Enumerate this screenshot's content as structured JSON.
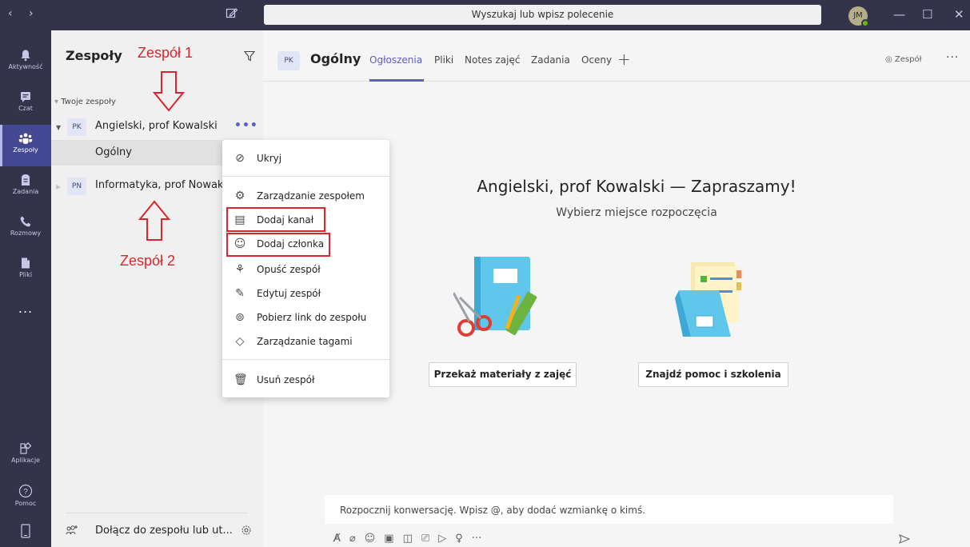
{
  "titlebar": {
    "search_text": "Wyszukaj lub wpisz polecenie",
    "avatar_initials": "JM"
  },
  "appbar": {
    "items": [
      {
        "label": "Aktywność",
        "icon": "bell-icon"
      },
      {
        "label": "Czat",
        "icon": "chat-icon"
      },
      {
        "label": "Zespoły",
        "icon": "teams-icon"
      },
      {
        "label": "Zadania",
        "icon": "assignments-icon"
      },
      {
        "label": "Rozmowy",
        "icon": "phone-icon"
      },
      {
        "label": "Pliki",
        "icon": "files-icon"
      },
      {
        "label": "Aplikacje",
        "icon": "apps-icon"
      },
      {
        "label": "Pomoc",
        "icon": "help-icon"
      }
    ],
    "more": "..."
  },
  "teams_pane": {
    "title": "Zespoły",
    "group_label": "Twoje zespoły",
    "teams": [
      {
        "initials": "PK",
        "name": "Angielski, prof Kowalski",
        "more": "•••"
      },
      {
        "initials": "PN",
        "name": "Informatyka, prof Nowak"
      }
    ],
    "channel": "Ogólny",
    "join_label": "Dołącz do zespołu lub ut..."
  },
  "main": {
    "avatar_initials": "PK",
    "channel_title": "Ogólny",
    "tabs": [
      "Ogłoszenia",
      "Pliki",
      "Notes zajęć",
      "Zadania",
      "Oceny"
    ],
    "team_button": "Zespół",
    "welcome_title": "Angielski, prof Kowalski — Zapraszamy!",
    "welcome_subtitle": "Wybierz miejsce rozpoczęcia",
    "cta1": "Przekaż materiały z zajęć",
    "cta2": "Znajdź pomoc i szkolenia",
    "composer_placeholder": "Rozpocznij konwersację. Wpisz @, aby dodać wzmiankę o kimś."
  },
  "context_menu": {
    "items": [
      {
        "label": "Ukryj",
        "icon": "hide-icon"
      },
      {
        "label": "Zarządzanie zespołem",
        "icon": "settings-icon"
      },
      {
        "label": "Dodaj kanał",
        "icon": "add-channel-icon"
      },
      {
        "label": "Dodaj członka",
        "icon": "add-member-icon"
      },
      {
        "label": "Opuść zespół",
        "icon": "leave-icon"
      },
      {
        "label": "Edytuj zespół",
        "icon": "edit-icon"
      },
      {
        "label": "Pobierz link do zespołu",
        "icon": "link-icon"
      },
      {
        "label": "Zarządzanie tagami",
        "icon": "tag-icon"
      },
      {
        "label": "Usuń zespół",
        "icon": "trash-icon"
      }
    ]
  },
  "annotations": {
    "team1": "Zespół 1",
    "team2": "Zespół 2"
  },
  "colors": {
    "brand": "#5b5fc7",
    "appbar": "#33344a",
    "annotation": "#d9262e"
  }
}
